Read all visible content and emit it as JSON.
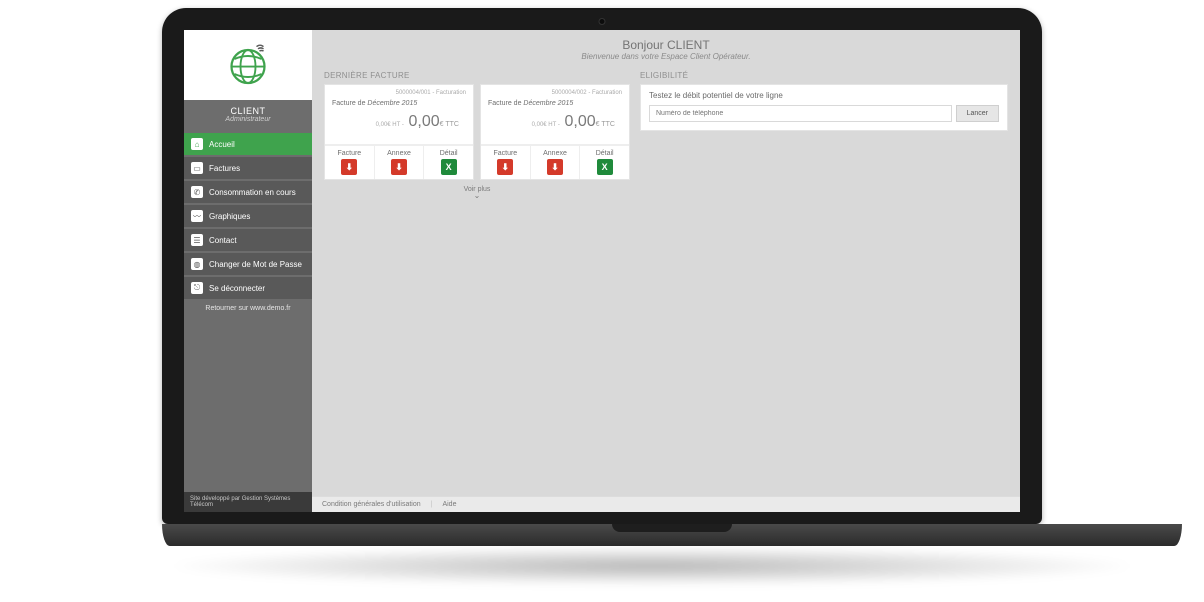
{
  "sidebar": {
    "client_name": "CLIENT",
    "client_role": "Administrateur",
    "items": [
      {
        "label": "Accueil",
        "icon_name": "home-icon",
        "glyph": "⌂",
        "active": true
      },
      {
        "label": "Factures",
        "icon_name": "invoice-icon",
        "glyph": "▭",
        "active": false
      },
      {
        "label": "Consommation en cours",
        "icon_name": "phone-icon",
        "glyph": "✆",
        "active": false
      },
      {
        "label": "Graphiques",
        "icon_name": "chart-icon",
        "glyph": "〰",
        "active": false
      },
      {
        "label": "Contact",
        "icon_name": "contact-icon",
        "glyph": "☰",
        "active": false
      },
      {
        "label": "Changer de Mot de Passe",
        "icon_name": "globe-icon",
        "glyph": "◍",
        "active": false
      },
      {
        "label": "Se déconnecter",
        "icon_name": "logout-icon",
        "glyph": "⎋",
        "active": false
      }
    ],
    "return_link": "Retourner sur www.demo.fr",
    "dev_footer": "Site développé par Gestion Systèmes Télécom"
  },
  "header": {
    "hello": "Bonjour CLIENT",
    "welcome": "Bienvenue dans votre Espace Client Opérateur."
  },
  "invoices": {
    "section_title": "DERNIÈRE FACTURE",
    "voir_plus": "Voir plus",
    "cards": [
      {
        "meta": "5000004/001 - Facturation",
        "title_prefix": "Facture de ",
        "title_em": "Décembre 2015",
        "ht": "0,00€ HT - ",
        "ttc": "0,00",
        "ttc_suffix": "€ TTC",
        "btns": {
          "facture": "Facture",
          "annexe": "Annexe",
          "detail": "Détail"
        }
      },
      {
        "meta": "5000004/002 - Facturation",
        "title_prefix": "Facture de ",
        "title_em": "Décembre 2015",
        "ht": "0,00€ HT - ",
        "ttc": "0,00",
        "ttc_suffix": "€ TTC",
        "btns": {
          "facture": "Facture",
          "annexe": "Annexe",
          "detail": "Détail"
        }
      }
    ]
  },
  "eligibility": {
    "section_title": "ELIGIBILITÉ",
    "text": "Testez le débit potentiel de votre ligne",
    "placeholder": "Numéro de téléphone",
    "button": "Lancer"
  },
  "footer": {
    "terms": "Condition générales d'utilisation",
    "help": "Aide"
  },
  "colors": {
    "accent": "#3fa34d",
    "pdf": "#d43a2a",
    "xls": "#1f8a3b"
  }
}
